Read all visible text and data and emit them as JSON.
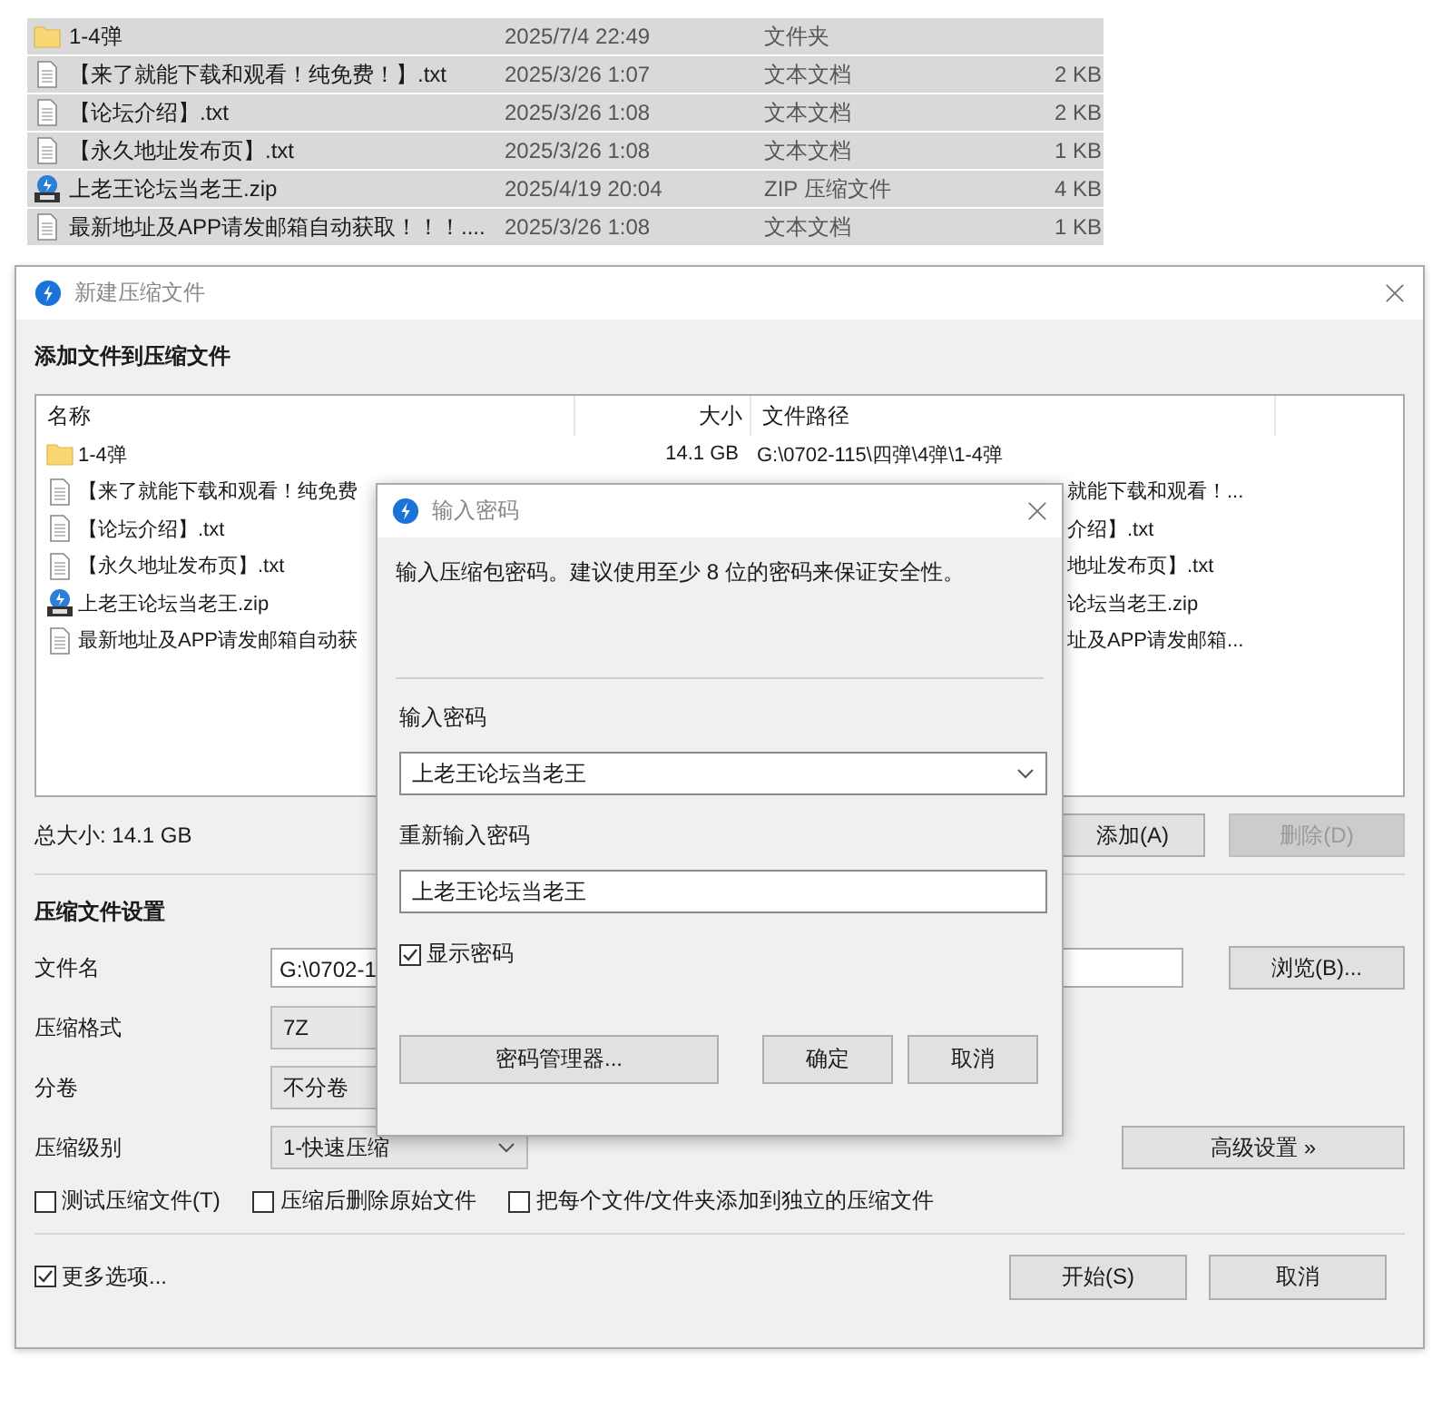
{
  "explorer": {
    "rows": [
      {
        "kind": "folder",
        "name": "1-4弹",
        "date": "2025/7/4 22:49",
        "type": "文件夹"
      },
      {
        "kind": "text",
        "name": "【来了就能下载和观看！纯免费！】.txt",
        "date": "2025/3/26 1:07",
        "type": "文本文档",
        "size": "2 KB"
      },
      {
        "kind": "text",
        "name": "【论坛介绍】.txt",
        "date": "2025/3/26 1:08",
        "type": "文本文档",
        "size": "2 KB"
      },
      {
        "kind": "text",
        "name": "【永久地址发布页】.txt",
        "date": "2025/3/26 1:08",
        "type": "文本文档",
        "size": "1 KB"
      },
      {
        "kind": "zip",
        "name": "上老王论坛当老王.zip",
        "date": "2025/4/19 20:04",
        "type": "ZIP 压缩文件",
        "size": "4 KB"
      },
      {
        "kind": "text",
        "name": "最新地址及APP请发邮箱自动获取！！！....",
        "date": "2025/3/26 1:08",
        "type": "文本文档",
        "size": "1 KB"
      }
    ]
  },
  "archive_window": {
    "title": "新建压缩文件",
    "heading": "添加文件到压缩文件",
    "list": {
      "columns": [
        "名称",
        "大小",
        "文件路径"
      ],
      "rows": [
        {
          "kind": "folder",
          "name": "1-4弹",
          "size": "14.1 GB",
          "path": "G:\\0702-115\\四弹\\4弹\\1-4弹"
        },
        {
          "kind": "text",
          "name": "【来了就能下载和观看！纯免费",
          "path": "就能下载和观看！..."
        },
        {
          "kind": "text",
          "name": "【论坛介绍】.txt",
          "path": "介绍】.txt"
        },
        {
          "kind": "text",
          "name": "【永久地址发布页】.txt",
          "path": "地址发布页】.txt"
        },
        {
          "kind": "zip",
          "name": "上老王论坛当老王.zip",
          "path": "论坛当老王.zip"
        },
        {
          "kind": "text",
          "name": "最新地址及APP请发邮箱自动获",
          "path": "址及APP请发邮箱..."
        }
      ]
    },
    "total": "总大小: 14.1 GB",
    "add_button": {
      "label": "添加(A)",
      "disabled": false
    },
    "delete_button": {
      "label": "删除(D)",
      "disabled": true
    },
    "settings_heading": "压缩文件设置",
    "fields": [
      {
        "kind": "text",
        "label": "文件名",
        "value": "G:\\0702-1"
      },
      {
        "kind": "clipped",
        "label": "压缩格式",
        "value": "7Z"
      },
      {
        "kind": "clipped",
        "label": "分卷",
        "value": "不分卷"
      },
      {
        "kind": "select",
        "label": "压缩级别",
        "value": "1-快速压缩"
      }
    ],
    "browse_button": "浏览(B)...",
    "advanced_button": "高级设置 »",
    "options": [
      {
        "label": "测试压缩文件(T)",
        "checked": false
      },
      {
        "label": "压缩后删除原始文件",
        "checked": false
      },
      {
        "label": "把每个文件/文件夹添加到独立的压缩文件",
        "checked": false
      }
    ],
    "more_options": {
      "label": "更多选项...",
      "checked": true
    },
    "start_button": "开始(S)",
    "cancel_button": "取消"
  },
  "password_dialog": {
    "title": "输入密码",
    "message": "输入压缩包密码。建议使用至少 8 位的密码来保证安全性。",
    "password_label": "输入密码",
    "password_value": "上老王论坛当老王",
    "confirm_label": "重新输入密码",
    "confirm_value": "上老王论坛当老王",
    "show_password": {
      "label": "显示密码",
      "checked": true
    },
    "manager_button": "密码管理器...",
    "ok_button": "确定",
    "cancel_button": "取消"
  }
}
